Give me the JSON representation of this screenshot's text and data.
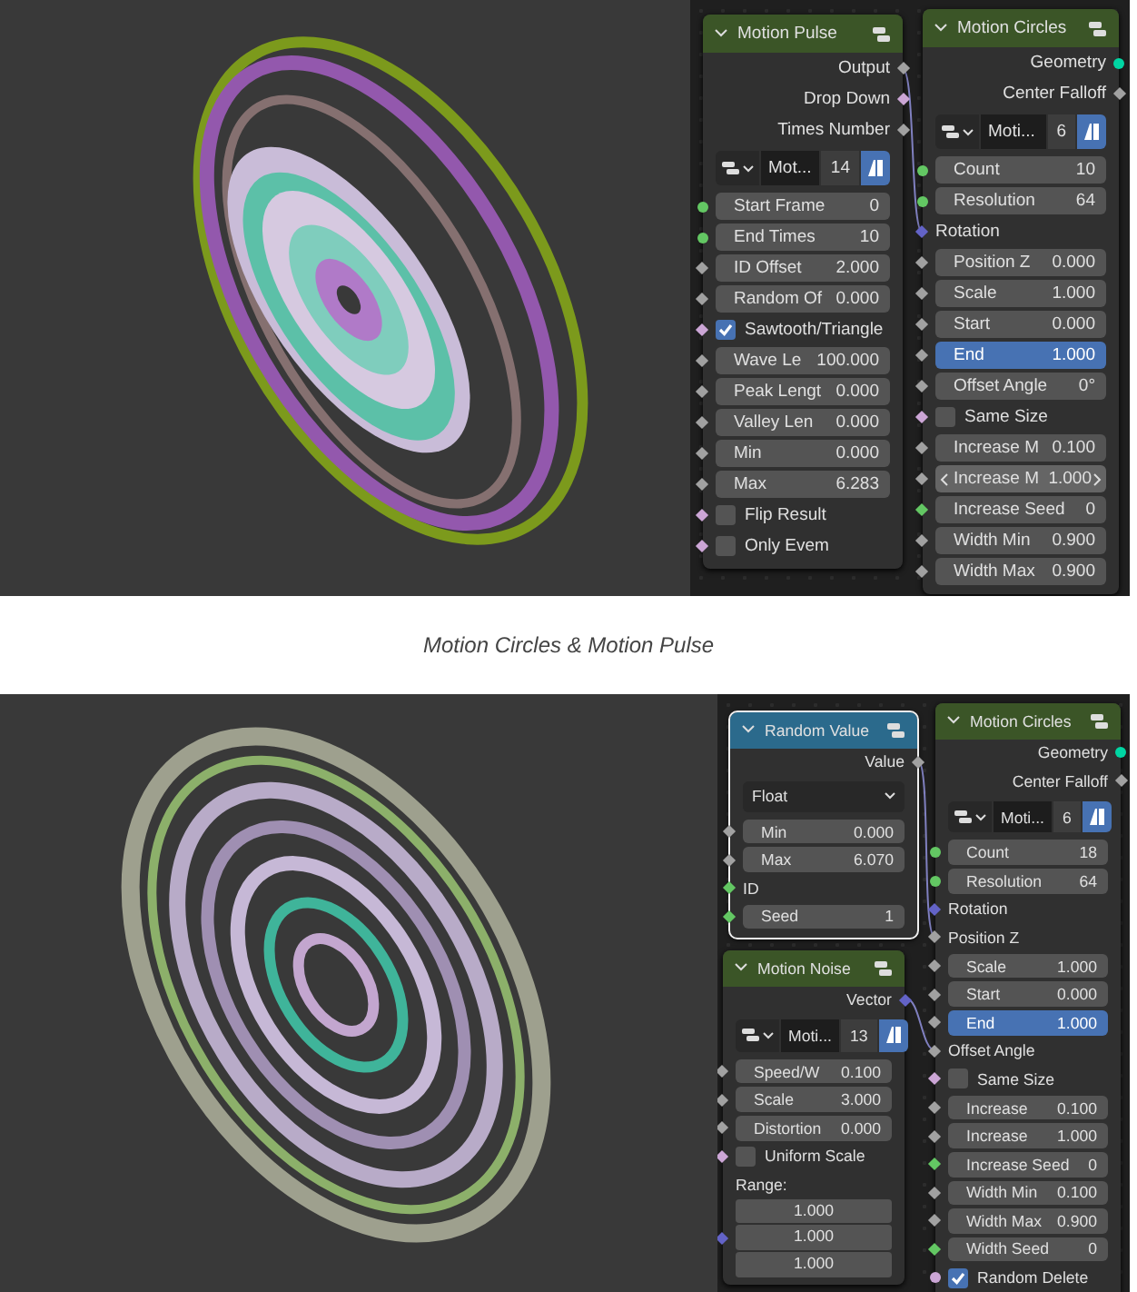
{
  "figures": [
    {
      "kind": "rings",
      "nodes": [
        {
          "title": "Motion Pulse",
          "color": "#3b5527",
          "selected": false,
          "rows": [
            {
              "kind": "output",
              "label": "Output",
              "color": "#a1a1a1",
              "diamond": true
            },
            {
              "kind": "output",
              "label": "Drop Down",
              "color": "#cca6d6",
              "diamond": true
            },
            {
              "kind": "output",
              "label": "Times Number",
              "color": "#a1a1a1",
              "diamond": true
            },
            {
              "kind": "datablock",
              "name": "Mot...",
              "users": "14"
            },
            {
              "kind": "field",
              "label": "Start Frame",
              "value": "0",
              "color": "#63c763",
              "diamond": false,
              "active": false,
              "hovered": false
            },
            {
              "kind": "field",
              "label": "End Times",
              "value": "10",
              "color": "#63c763",
              "diamond": false,
              "active": false,
              "hovered": false
            },
            {
              "kind": "field",
              "label": "ID Offset",
              "value": "2.000",
              "color": "#a1a1a1",
              "diamond": true,
              "active": false,
              "hovered": false
            },
            {
              "kind": "field",
              "label": "Random Of",
              "value": "0.000",
              "color": "#a1a1a1",
              "diamond": true,
              "active": false,
              "hovered": false
            },
            {
              "kind": "checkbox",
              "label": "Sawtooth/Triangle",
              "checked": true,
              "color": "#cca6d6",
              "diamond": true
            },
            {
              "kind": "field",
              "label": "Wave Le",
              "value": "100.000",
              "color": "#a1a1a1",
              "diamond": true,
              "active": false,
              "hovered": false
            },
            {
              "kind": "field",
              "label": "Peak Lengt",
              "value": "0.000",
              "color": "#a1a1a1",
              "diamond": true,
              "active": false,
              "hovered": false
            },
            {
              "kind": "field",
              "label": "Valley Len",
              "value": "0.000",
              "color": "#a1a1a1",
              "diamond": true,
              "active": false,
              "hovered": false
            },
            {
              "kind": "field",
              "label": "Min",
              "value": "0.000",
              "color": "#a1a1a1",
              "diamond": true,
              "active": false,
              "hovered": false
            },
            {
              "kind": "field",
              "label": "Max",
              "value": "6.283",
              "color": "#a1a1a1",
              "diamond": true,
              "active": false,
              "hovered": false
            },
            {
              "kind": "checkbox",
              "label": "Flip Result",
              "checked": false,
              "color": "#cca6d6",
              "diamond": true
            },
            {
              "kind": "checkbox",
              "label": "Only Evem",
              "checked": false,
              "color": "#cca6d6",
              "diamond": true
            }
          ]
        },
        {
          "title": "Motion Circles",
          "color": "#3b5527",
          "selected": false,
          "rows": [
            {
              "kind": "output",
              "label": "Geometry",
              "color": "#00d6a3",
              "diamond": false
            },
            {
              "kind": "output",
              "label": "Center Falloff",
              "color": "#a1a1a1",
              "diamond": true
            },
            {
              "kind": "datablock",
              "name": "Moti...",
              "users": "6"
            },
            {
              "kind": "field",
              "label": "Count",
              "value": "10",
              "color": "#63c763",
              "diamond": false,
              "active": false,
              "hovered": false
            },
            {
              "kind": "field",
              "label": "Resolution",
              "value": "64",
              "color": "#63c763",
              "diamond": false,
              "active": false,
              "hovered": false
            },
            {
              "kind": "input",
              "label": "Rotation",
              "color": "#6363c7",
              "diamond": true
            },
            {
              "kind": "field",
              "label": "Position Z",
              "value": "0.000",
              "color": "#a1a1a1",
              "diamond": true,
              "active": false,
              "hovered": false
            },
            {
              "kind": "field",
              "label": "Scale",
              "value": "1.000",
              "color": "#a1a1a1",
              "diamond": true,
              "active": false,
              "hovered": false
            },
            {
              "kind": "field",
              "label": "Start",
              "value": "0.000",
              "color": "#a1a1a1",
              "diamond": true,
              "active": false,
              "hovered": false
            },
            {
              "kind": "field",
              "label": "End",
              "value": "1.000",
              "color": "#a1a1a1",
              "diamond": true,
              "active": true,
              "hovered": false
            },
            {
              "kind": "field",
              "label": "Offset Angle",
              "value": "0°",
              "color": "#a1a1a1",
              "diamond": true,
              "active": false,
              "hovered": false
            },
            {
              "kind": "checkbox",
              "label": "Same Size",
              "checked": false,
              "color": "#cca6d6",
              "diamond": true
            },
            {
              "kind": "field",
              "label": "Increase M",
              "value": "0.100",
              "color": "#a1a1a1",
              "diamond": true,
              "active": false,
              "hovered": false
            },
            {
              "kind": "field",
              "label": "Increase M",
              "value": "1.000",
              "color": "#a1a1a1",
              "diamond": true,
              "active": false,
              "hovered": true
            },
            {
              "kind": "field",
              "label": "Increase Seed",
              "value": "0",
              "color": "#63c763",
              "diamond": true,
              "active": false,
              "hovered": false
            },
            {
              "kind": "field",
              "label": "Width Min",
              "value": "0.900",
              "color": "#a1a1a1",
              "diamond": true,
              "active": false,
              "hovered": false
            },
            {
              "kind": "field",
              "label": "Width Max",
              "value": "0.900",
              "color": "#a1a1a1",
              "diamond": true,
              "active": false,
              "hovered": false
            }
          ]
        }
      ],
      "caption": "Motion Circles & Motion Pulse"
    },
    {
      "kind": "disc",
      "nodes": [
        {
          "title": "Random Value",
          "color": "#2b6a8c",
          "selected": true,
          "rows": [
            {
              "kind": "output",
              "label": "Value",
              "color": "#a1a1a1",
              "diamond": true
            },
            {
              "kind": "dropdown",
              "value": "Float"
            },
            {
              "kind": "field",
              "label": "Min",
              "value": "0.000",
              "color": "#a1a1a1",
              "diamond": true,
              "active": false,
              "hovered": false
            },
            {
              "kind": "field",
              "label": "Max",
              "value": "6.070",
              "color": "#a1a1a1",
              "diamond": true,
              "active": false,
              "hovered": false
            },
            {
              "kind": "input",
              "label": "ID",
              "color": "#63c763",
              "diamond": true
            },
            {
              "kind": "field",
              "label": "Seed",
              "value": "1",
              "color": "#63c763",
              "diamond": true,
              "active": false,
              "hovered": false
            }
          ]
        },
        {
          "title": "Motion Noise",
          "color": "#3b5527",
          "selected": false,
          "rows": [
            {
              "kind": "output",
              "label": "Vector",
              "color": "#6363c7",
              "diamond": true
            },
            {
              "kind": "datablock",
              "name": "Moti...",
              "users": "13"
            },
            {
              "kind": "field",
              "label": "Speed/W",
              "value": "0.100",
              "color": "#a1a1a1",
              "diamond": true,
              "active": false,
              "hovered": false
            },
            {
              "kind": "field",
              "label": "Scale",
              "value": "3.000",
              "color": "#a1a1a1",
              "diamond": true,
              "active": false,
              "hovered": false
            },
            {
              "kind": "field",
              "label": "Distortion",
              "value": "0.000",
              "color": "#a1a1a1",
              "diamond": true,
              "active": false,
              "hovered": false
            },
            {
              "kind": "checkbox",
              "label": "Uniform Scale",
              "checked": false,
              "color": "#cca6d6",
              "diamond": true
            },
            {
              "kind": "label",
              "label": "Range:"
            },
            {
              "kind": "vector",
              "values": [
                "1.000",
                "1.000",
                "1.000"
              ],
              "color": "#6363c7",
              "diamond": true
            }
          ]
        },
        {
          "title": "Motion Circles",
          "color": "#3b5527",
          "selected": false,
          "rows": [
            {
              "kind": "output",
              "label": "Geometry",
              "color": "#00d6a3",
              "diamond": false
            },
            {
              "kind": "output",
              "label": "Center Falloff",
              "color": "#a1a1a1",
              "diamond": true
            },
            {
              "kind": "datablock",
              "name": "Moti...",
              "users": "6"
            },
            {
              "kind": "field",
              "label": "Count",
              "value": "18",
              "color": "#63c763",
              "diamond": false,
              "active": false,
              "hovered": false
            },
            {
              "kind": "field",
              "label": "Resolution",
              "value": "64",
              "color": "#63c763",
              "diamond": false,
              "active": false,
              "hovered": false
            },
            {
              "kind": "input",
              "label": "Rotation",
              "color": "#6363c7",
              "diamond": true
            },
            {
              "kind": "input",
              "label": "Position Z",
              "color": "#a1a1a1",
              "diamond": true
            },
            {
              "kind": "field",
              "label": "Scale",
              "value": "1.000",
              "color": "#a1a1a1",
              "diamond": true,
              "active": false,
              "hovered": false
            },
            {
              "kind": "field",
              "label": "Start",
              "value": "0.000",
              "color": "#a1a1a1",
              "diamond": true,
              "active": false,
              "hovered": false
            },
            {
              "kind": "field",
              "label": "End",
              "value": "1.000",
              "color": "#a1a1a1",
              "diamond": true,
              "active": true,
              "hovered": false
            },
            {
              "kind": "input",
              "label": "Offset Angle",
              "color": "#a1a1a1",
              "diamond": true
            },
            {
              "kind": "checkbox",
              "label": "Same Size",
              "checked": false,
              "color": "#cca6d6",
              "diamond": true
            },
            {
              "kind": "field",
              "label": "Increase",
              "value": "0.100",
              "color": "#a1a1a1",
              "diamond": true,
              "active": false,
              "hovered": false
            },
            {
              "kind": "field",
              "label": "Increase",
              "value": "1.000",
              "color": "#a1a1a1",
              "diamond": true,
              "active": false,
              "hovered": false
            },
            {
              "kind": "field",
              "label": "Increase Seed",
              "value": "0",
              "color": "#63c763",
              "diamond": true,
              "active": false,
              "hovered": false
            },
            {
              "kind": "field",
              "label": "Width Min",
              "value": "0.100",
              "color": "#a1a1a1",
              "diamond": true,
              "active": false,
              "hovered": false
            },
            {
              "kind": "field",
              "label": "Width Max",
              "value": "0.900",
              "color": "#a1a1a1",
              "diamond": true,
              "active": false,
              "hovered": false
            },
            {
              "kind": "field",
              "label": "Width Seed",
              "value": "0",
              "color": "#63c763",
              "diamond": true,
              "active": false,
              "hovered": false
            },
            {
              "kind": "checkbox",
              "label": "Random Delete",
              "checked": true,
              "color": "#cca6d6",
              "diamond": false
            }
          ]
        }
      ]
    }
  ]
}
